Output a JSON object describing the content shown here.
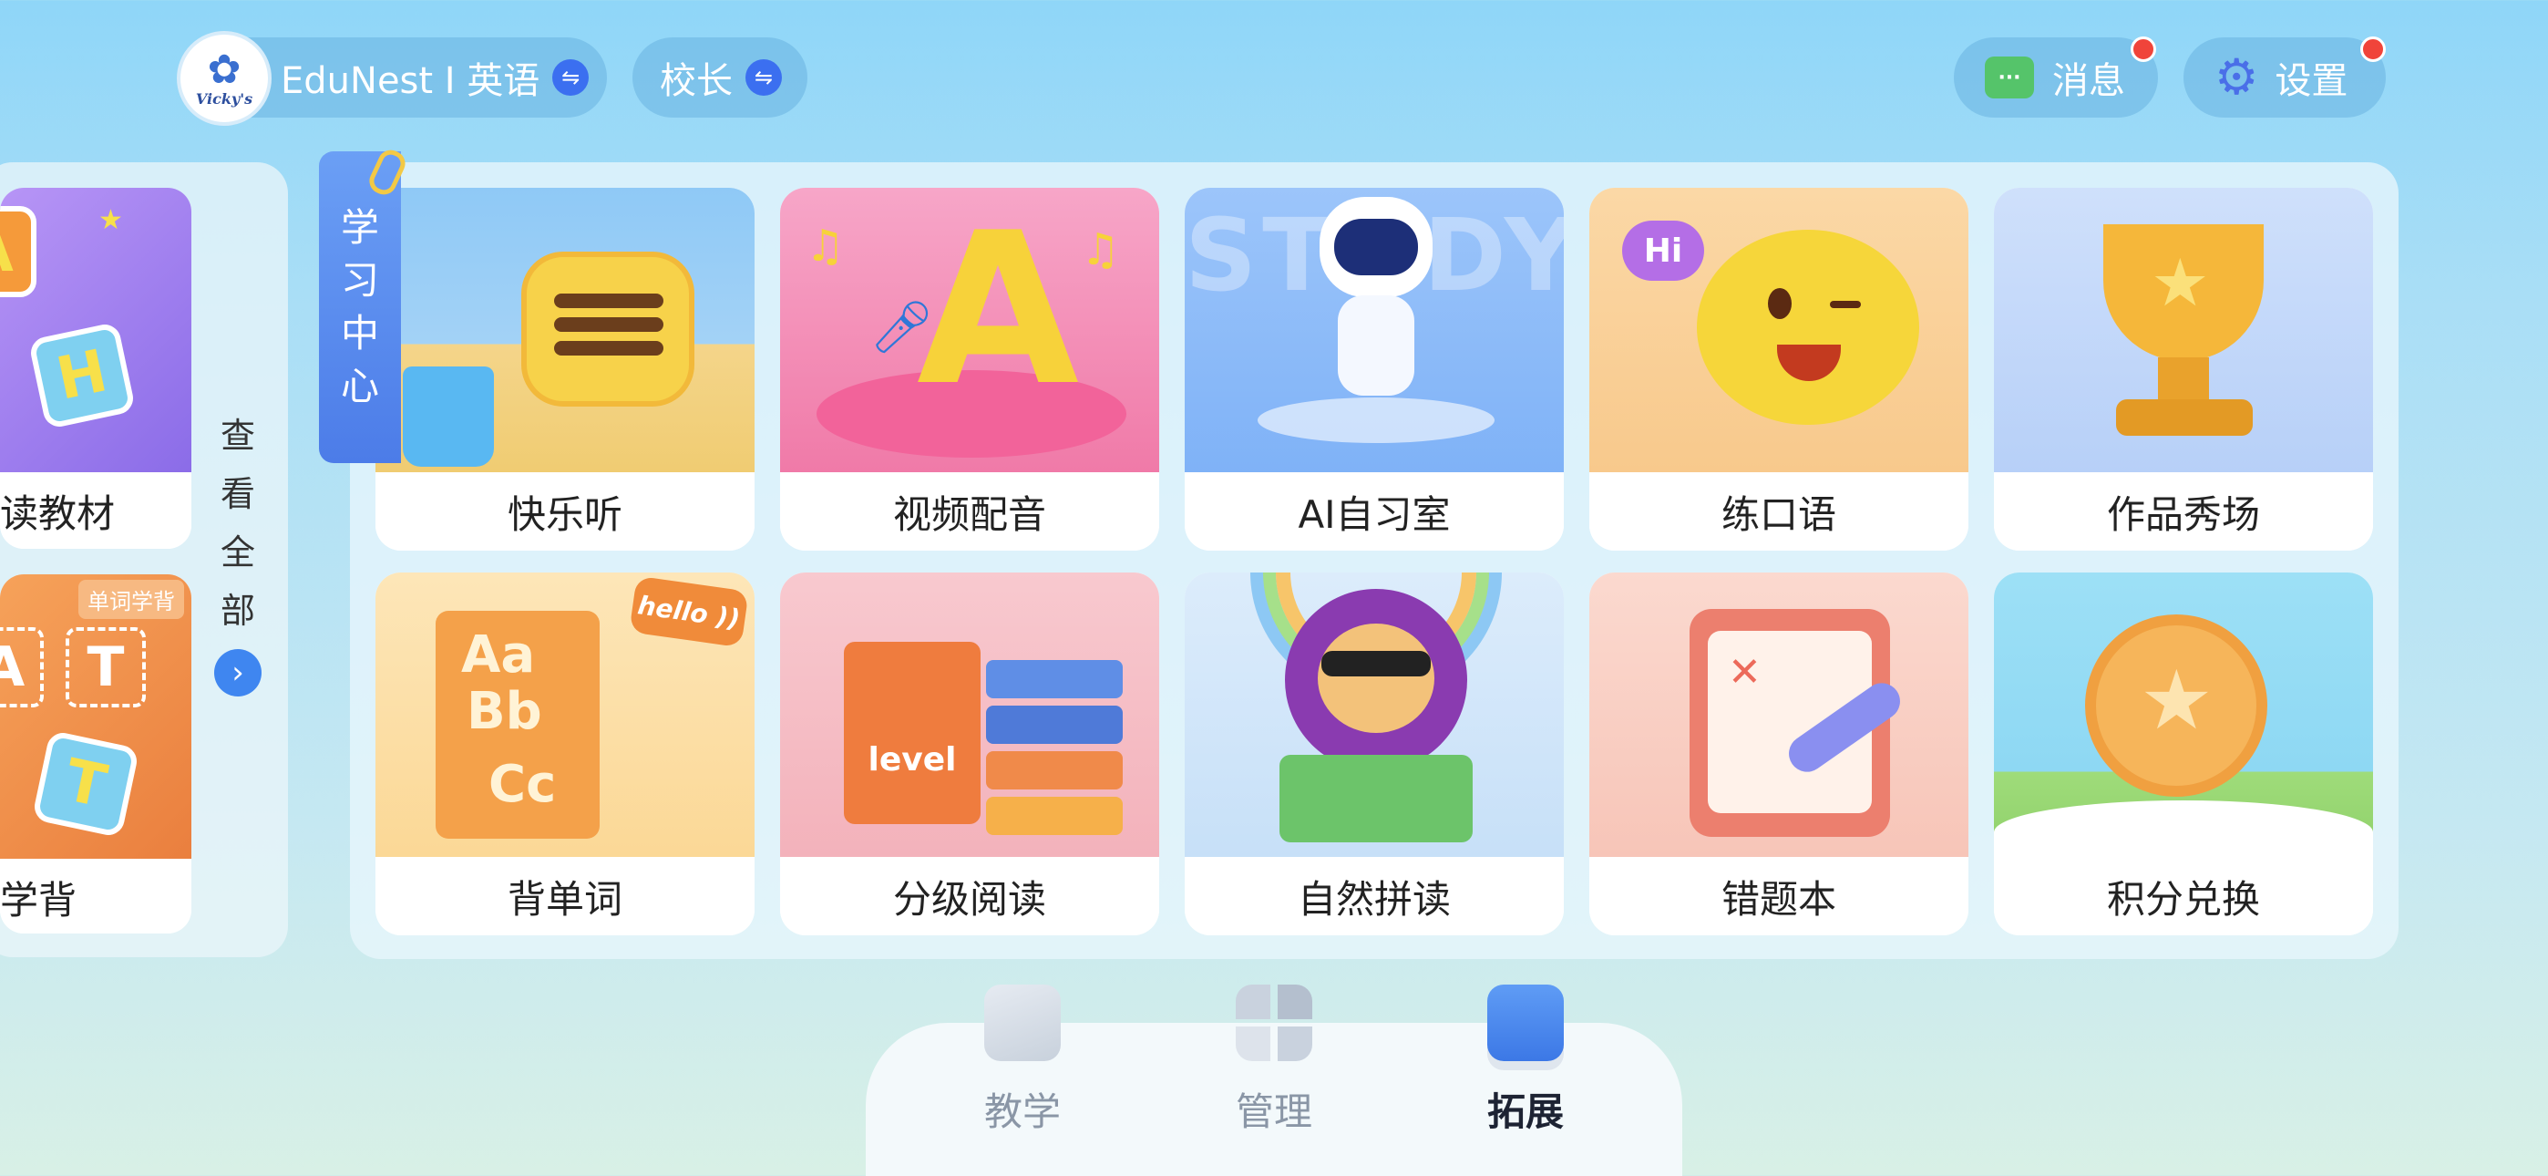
{
  "header": {
    "org_label": "EduNest I 英语",
    "logo_text": "Vicky's",
    "role_label": "校长",
    "messages_label": "消息",
    "messages_icon_text": "···",
    "settings_label": "设置"
  },
  "left_panel": {
    "items": [
      {
        "label": "读教材"
      },
      {
        "label": "学背",
        "tag": "单词学背"
      }
    ],
    "view_all": [
      "查",
      "看",
      "全",
      "部"
    ]
  },
  "learning_center": {
    "ribbon": [
      "学",
      "习",
      "中",
      "心"
    ],
    "cards": [
      {
        "label": "快乐听"
      },
      {
        "label": "视频配音"
      },
      {
        "label": "AI自习室"
      },
      {
        "label": "练口语"
      },
      {
        "label": "作品秀场"
      },
      {
        "label": "背单词"
      },
      {
        "label": "分级阅读"
      },
      {
        "label": "自然拼读"
      },
      {
        "label": "错题本"
      },
      {
        "label": "积分兑换"
      }
    ]
  },
  "art_text": {
    "hi": "Hi",
    "hello": "hello ))",
    "level": "level",
    "study": "STUDY",
    "letters": [
      "Aa",
      "Bb",
      "Cc",
      "A",
      "H",
      "T",
      "A",
      "T"
    ]
  },
  "bottom_nav": {
    "items": [
      {
        "label": "教学"
      },
      {
        "label": "管理"
      },
      {
        "label": "拓展",
        "active": true
      }
    ]
  },
  "colors": {
    "accent": "#3f86f0",
    "badge": "#f0443a",
    "message_green": "#55c46a"
  }
}
